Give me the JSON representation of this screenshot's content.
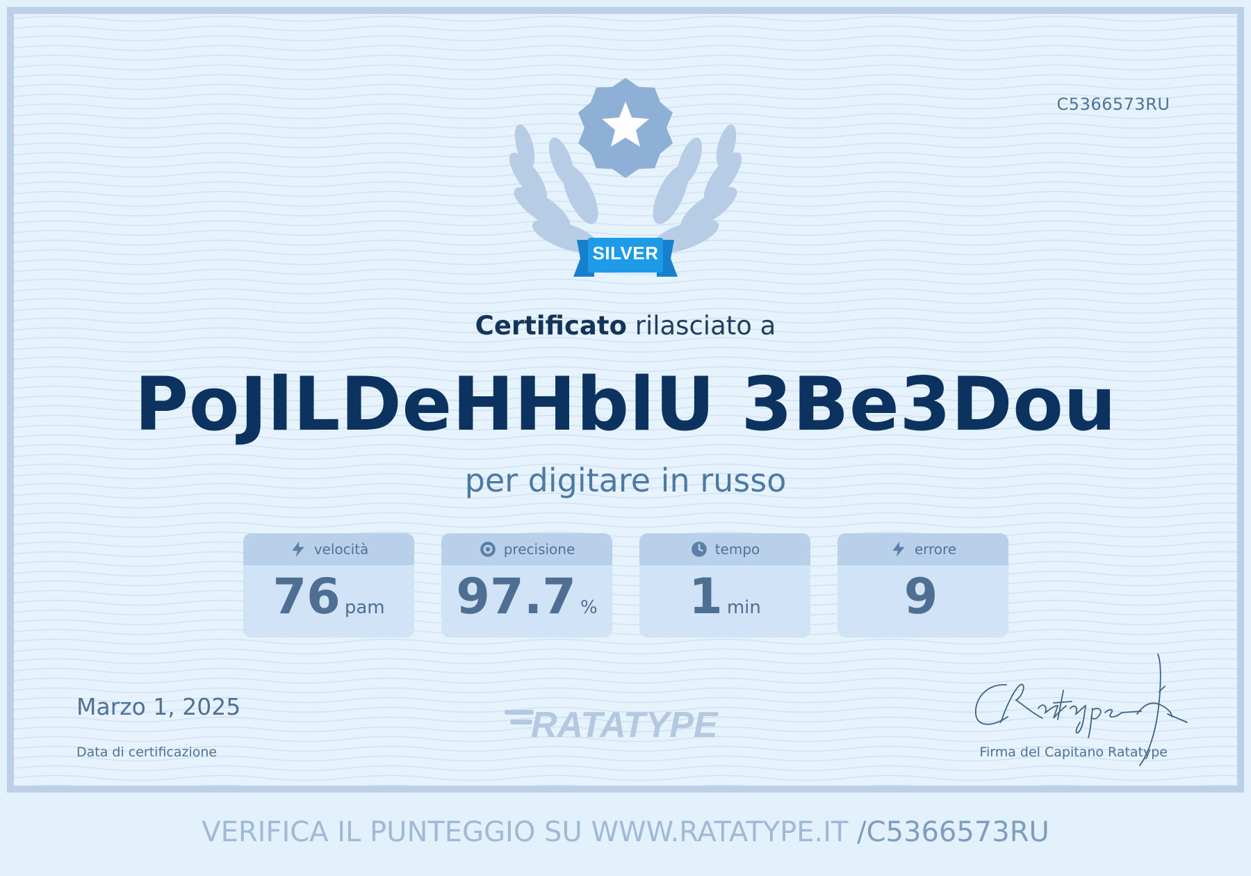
{
  "certificate": {
    "id": "C5366573RU",
    "badge": "SILVER",
    "issued_bold": "Certificato",
    "issued_rest": " rilasciato a",
    "recipient": "PoJlLDeHHblU 3Be3Dou",
    "subject": "per digitare in russo"
  },
  "stats": [
    {
      "label": "velocità",
      "value": "76",
      "unit": "pam",
      "icon": "lightning-icon"
    },
    {
      "label": "precisione",
      "value": "97.7",
      "unit": "%",
      "icon": "target-icon"
    },
    {
      "label": "tempo",
      "value": "1",
      "unit": "min",
      "icon": "clock-icon"
    },
    {
      "label": "errore",
      "value": "9",
      "unit": "",
      "icon": "lightning-icon"
    }
  ],
  "footer": {
    "date": "Marzo 1, 2025",
    "date_label": "Data di certificazione",
    "logo_text": "RATATYPE",
    "signature_label": "Firma del Capitano Ratatype",
    "verify_text": "VERIFICA IL PUNTEGGIO SU WWW.RATATYPE.IT ",
    "verify_code": "/C5366573RU"
  },
  "colors": {
    "background": "#e6f2fc",
    "frame": "#bcd0e8",
    "name": "#0c3360",
    "ribbon": "#1e9be8",
    "badge": "#8eb0d6"
  }
}
